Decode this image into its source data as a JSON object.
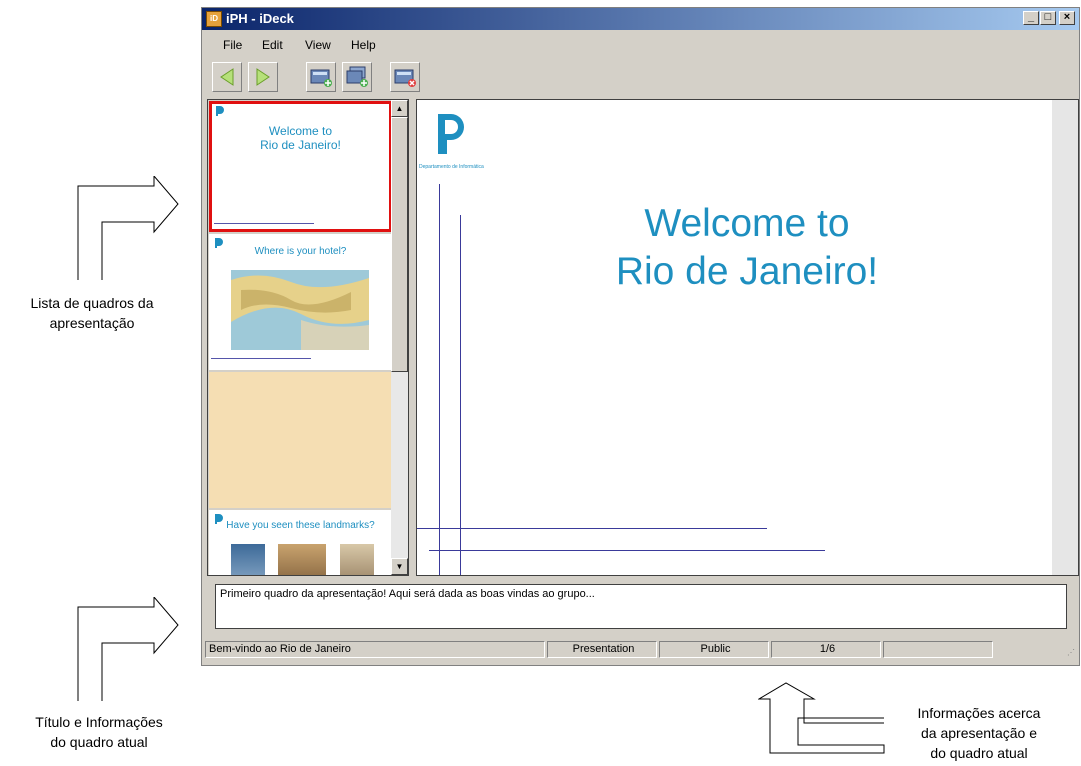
{
  "window": {
    "title": "iPH - iDeck",
    "app_icon": "ideck-app-icon",
    "buttons": [
      "minimize",
      "maximize",
      "close"
    ]
  },
  "menu": [
    "File",
    "Edit",
    "View",
    "Help"
  ],
  "toolbar": {
    "icons": [
      "back-arrow-icon",
      "forward-arrow-icon",
      "new-slide-icon",
      "duplicate-slide-icon",
      "delete-slide-icon"
    ]
  },
  "thumbnails": [
    {
      "title_line1": "Welcome to",
      "title_line2": "Rio de Janeiro!",
      "selected": true
    },
    {
      "title": "Where is your hotel?",
      "image": "rio-map"
    },
    {
      "title": "",
      "color": "#f5deb3"
    },
    {
      "title": "Have you seen these landmarks?"
    }
  ],
  "slide": {
    "org_caption": "Departamento de Informática",
    "title_line1": "Welcome to",
    "title_line2": "Rio de Janeiro!",
    "title_color": "#1e8fc0",
    "line_color": "#3a3a9a"
  },
  "notes": "Primeiro quadro da apresentação! Aqui será dada as boas vindas ao grupo...",
  "status": {
    "title": "Bem-vindo ao Rio de Janeiro",
    "mode": "Presentation",
    "visibility": "Public",
    "page": "1/6",
    "extra": ""
  },
  "annotations": {
    "list_line1": "Lista de quadros da",
    "list_line2": "apresentação",
    "title_line1": "Título e Informações",
    "title_line2": "do quadro atual",
    "info_line1": "Informações acerca",
    "info_line2": "da apresentação e",
    "info_line3": "do quadro atual"
  }
}
